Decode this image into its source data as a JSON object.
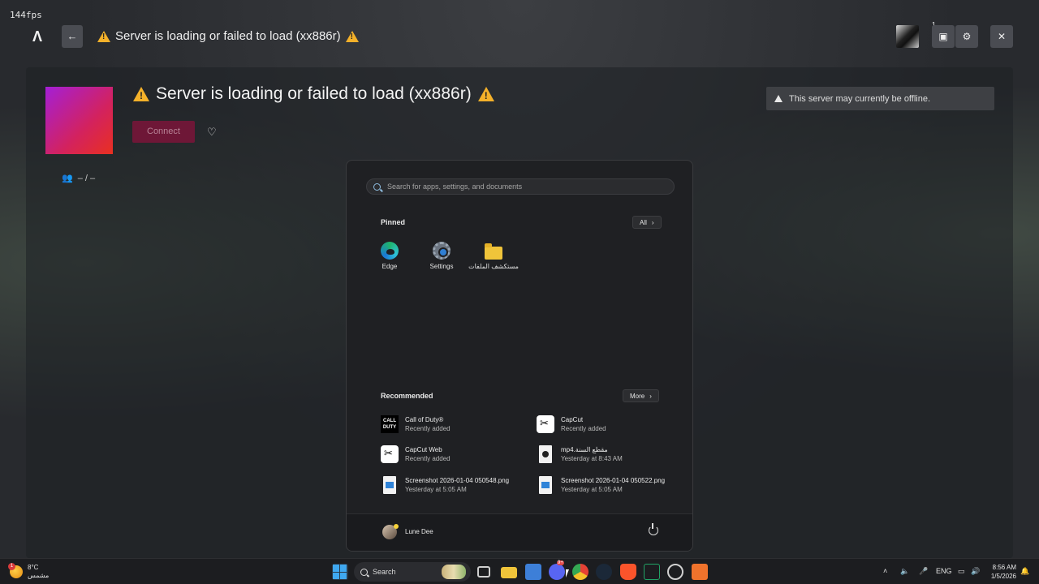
{
  "fps": "144fps",
  "topbar": {
    "back_label": "←",
    "title": "Server is loading or failed to load (xx886r)",
    "notification_count": "1",
    "close_label": "✕"
  },
  "server": {
    "title": "Server is loading or failed to load (xx886r)",
    "connect_label": "Connect",
    "players": "– / –",
    "offline_notice": "This server may currently be offline.",
    "icon_gradient": [
      "#a41fd6",
      "#e93020"
    ],
    "connect_color": "#6e1737"
  },
  "start_menu": {
    "search_placeholder": "Search for apps, settings, and documents",
    "pinned_label": "Pinned",
    "all_label": "All",
    "pinned": [
      {
        "label": "Edge",
        "icon": "edge-icon"
      },
      {
        "label": "Settings",
        "icon": "settings-gear-icon"
      },
      {
        "label": "مستكشف الملفات",
        "icon": "folder-icon"
      }
    ],
    "recommended_label": "Recommended",
    "more_label": "More",
    "recommended": [
      {
        "title": "Call of Duty®",
        "subtitle": "Recently added",
        "icon": "call-of-duty-icon"
      },
      {
        "title": "CapCut",
        "subtitle": "Recently added",
        "icon": "capcut-icon"
      },
      {
        "title": "CapCut Web",
        "subtitle": "Recently added",
        "icon": "capcut-icon"
      },
      {
        "title": "mp4.مقطع السنة",
        "subtitle": "Yesterday at 8:43 AM",
        "icon": "video-file-icon"
      },
      {
        "title": "Screenshot 2026-01-04 050548.png",
        "subtitle": "Yesterday at 5:05 AM",
        "icon": "image-file-icon"
      },
      {
        "title": "Screenshot 2026-01-04 050522.png",
        "subtitle": "Yesterday at 5:05 AM",
        "icon": "image-file-icon"
      }
    ],
    "user_name": "Lune Dee"
  },
  "taskbar": {
    "weather_temp": "8°C",
    "weather_desc": "مشمس",
    "weather_badge": "1",
    "search_label": "Search",
    "language": "ENG",
    "time": "8:56 AM",
    "date": "1/5/2026",
    "discord_badge": "9+"
  }
}
